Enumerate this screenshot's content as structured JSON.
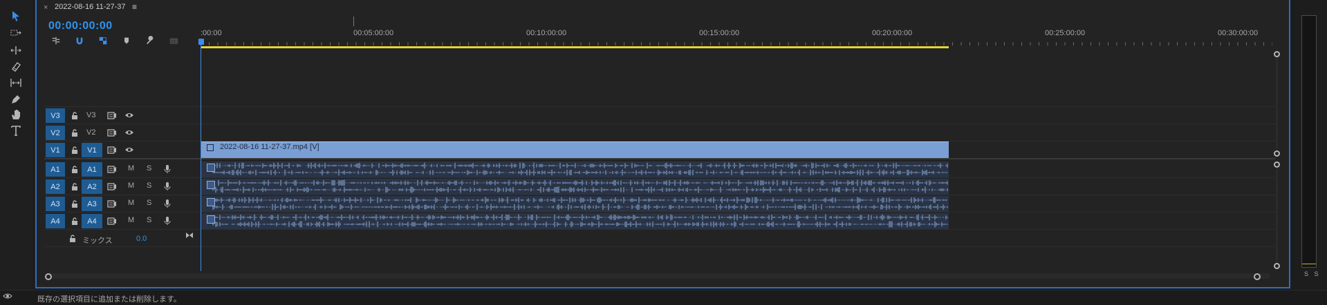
{
  "window": {
    "tab_close": "×",
    "tab_title": "2022-08-16 11-27-37",
    "tab_menu": "≡"
  },
  "timeline": {
    "timecode": "00:00:00:00",
    "ruler_labels": [
      ":00:00",
      "00:05:00:00",
      "00:10:00:00",
      "00:15:00:00",
      "00:20:00:00",
      "00:25:00:00",
      "00:30:00:00"
    ],
    "video_tracks": [
      {
        "target": "V3",
        "name": "V3"
      },
      {
        "target": "V2",
        "name": "V2"
      },
      {
        "target": "V1",
        "name": "V1"
      }
    ],
    "audio_tracks": [
      {
        "target": "A1",
        "name": "A1",
        "mute": "M",
        "solo": "S"
      },
      {
        "target": "A2",
        "name": "A2",
        "mute": "M",
        "solo": "S"
      },
      {
        "target": "A3",
        "name": "A3",
        "mute": "M",
        "solo": "S"
      },
      {
        "target": "A4",
        "name": "A4",
        "mute": "M",
        "solo": "S"
      }
    ],
    "video_clip_label": "2022-08-16 11-27-37.mp4 [V]",
    "mix_label": "ミックス",
    "mix_value": "0.0"
  },
  "meter": {
    "label": "S S"
  },
  "status_bar": {
    "text": "既存の選択項目に追加または削除します。"
  },
  "colors": {
    "accent": "#2f93f0",
    "track_target": "#1f5c93",
    "clip": "#7a9fd4",
    "work_area": "#e9d335",
    "panel_border": "#2d6ec2"
  },
  "icons": {
    "tools": [
      "selection-tool-icon",
      "track-select-forward-icon",
      "ripple-edit-icon",
      "razor-icon",
      "slip-icon",
      "pen-icon",
      "hand-icon",
      "type-icon"
    ],
    "controls": [
      "insert-nest-icon",
      "snap-icon",
      "linked-selection-icon",
      "add-marker-icon",
      "timeline-settings-icon",
      "captions-icon"
    ]
  }
}
